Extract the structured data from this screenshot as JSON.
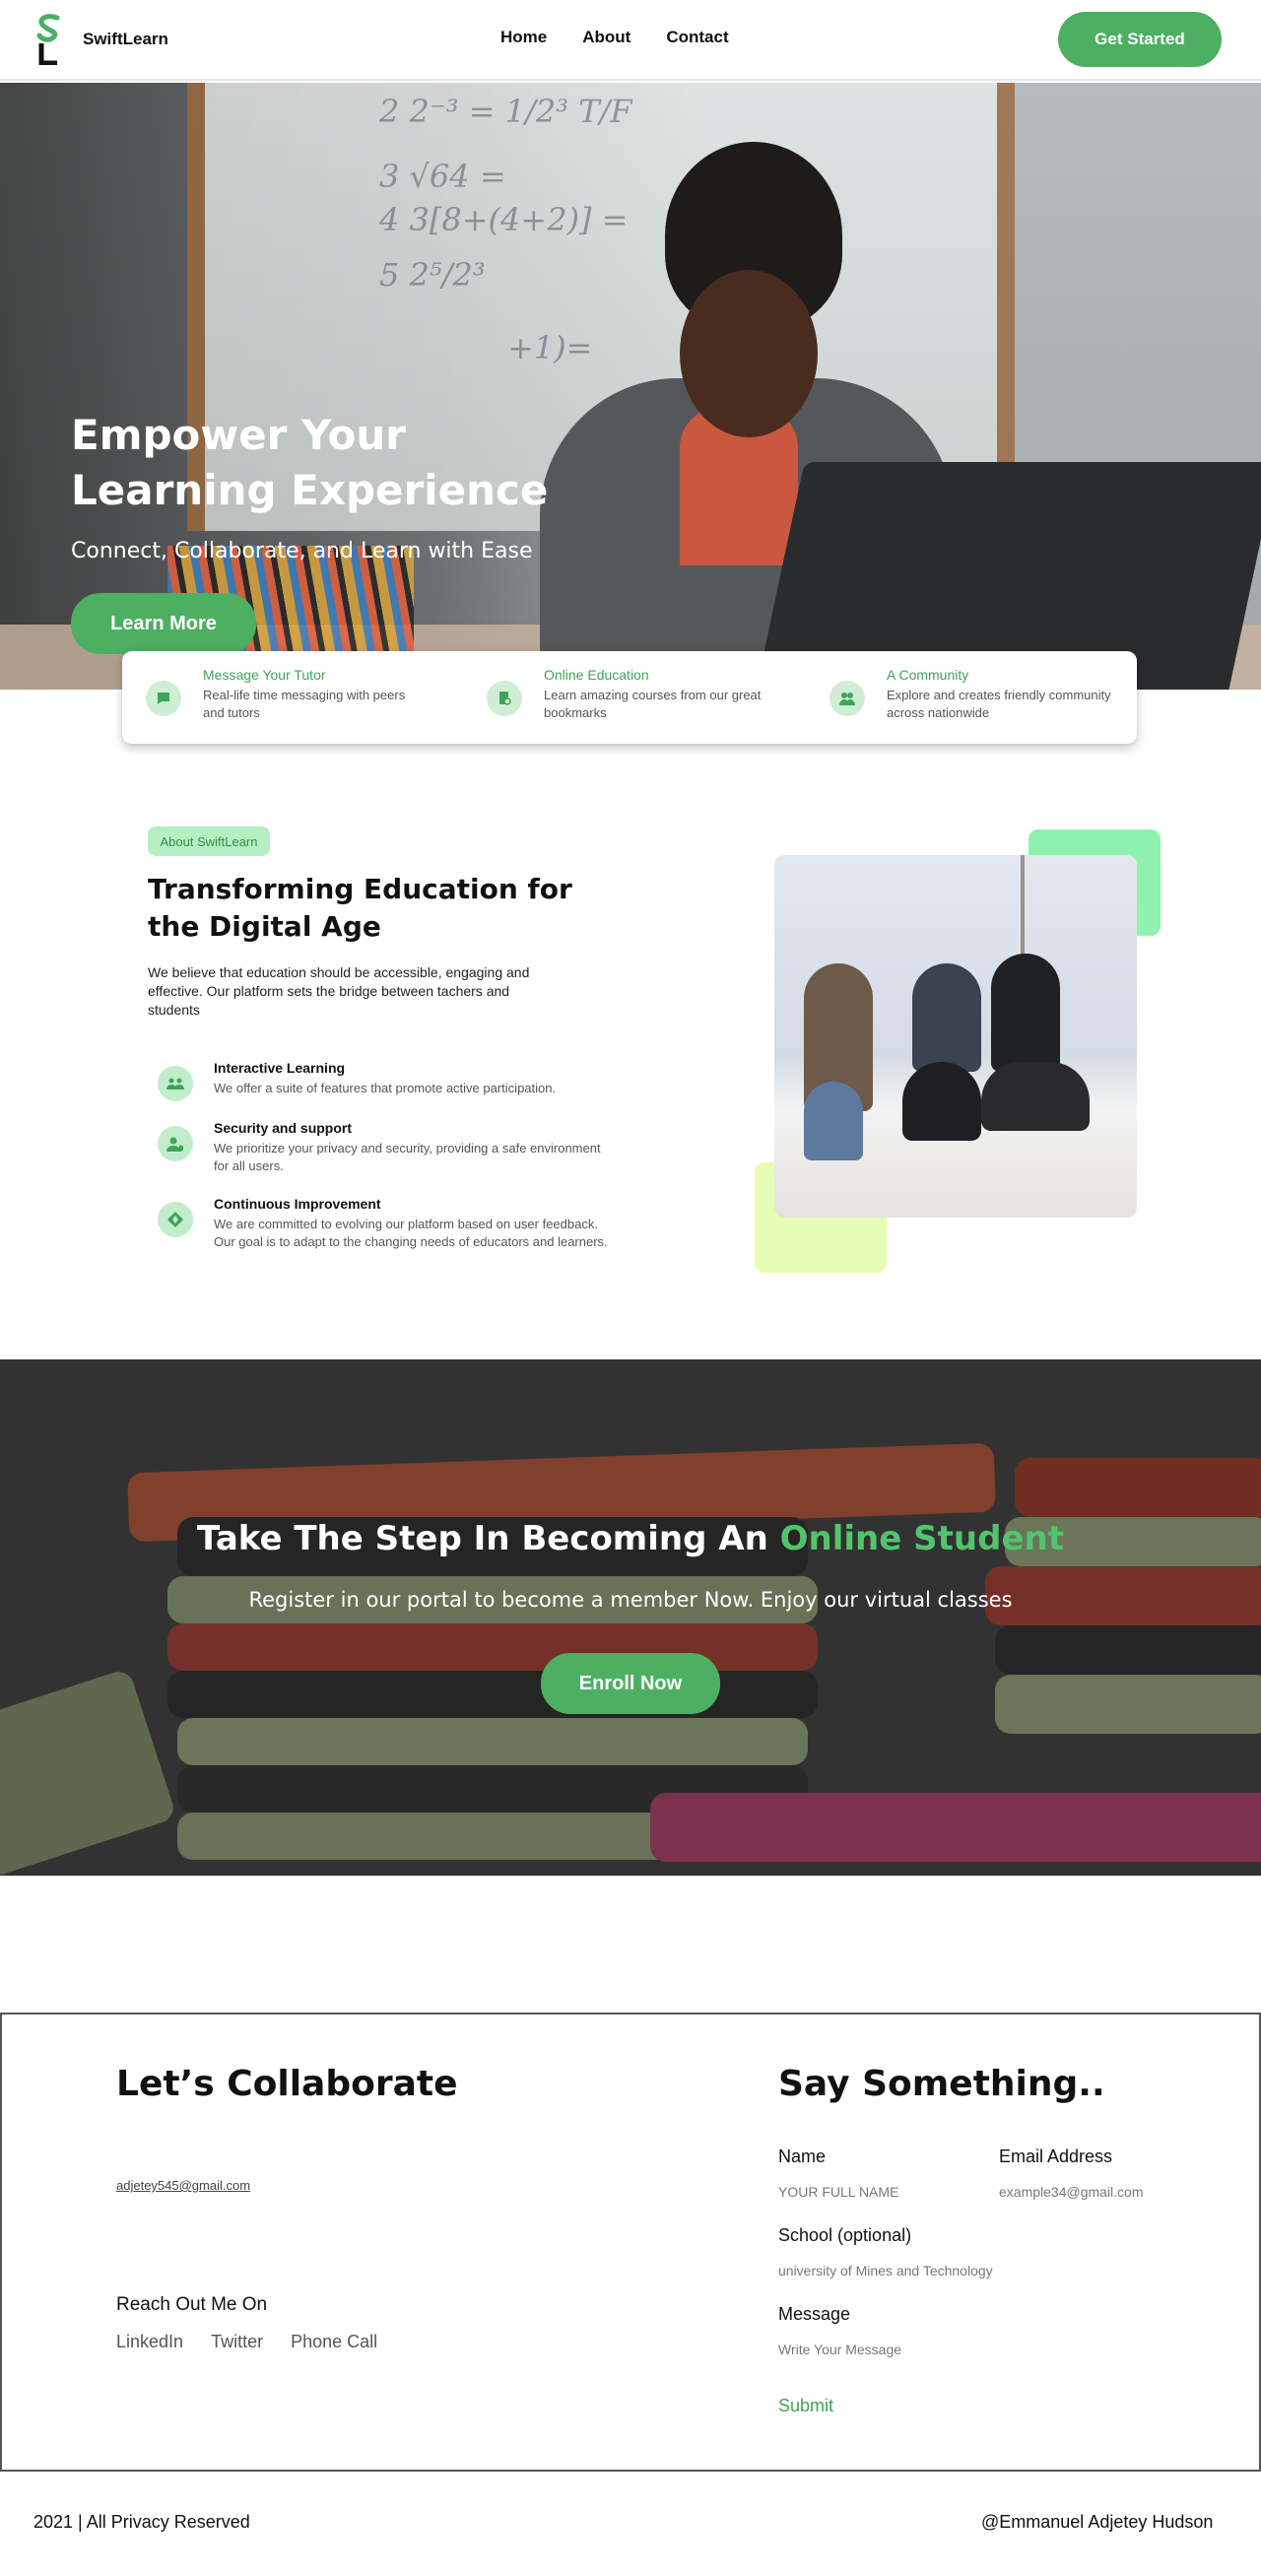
{
  "colors": {
    "accent": "#4caf62",
    "accent_text": "#3fa35a",
    "mint": "#8ff2ae",
    "lime": "#e7fcb4",
    "tag_bg": "#b7efc4"
  },
  "nav": {
    "brand": "SwiftLearn",
    "logo_letters": "SL",
    "links": [
      "Home",
      "About",
      "Contact"
    ],
    "cta": "Get Started"
  },
  "hero": {
    "title": "Empower Your Learning Experience",
    "subtitle": "Connect, Collaborate, and Learn with Ease",
    "button": "Learn More",
    "board_lines": [
      "2   2⁻³ = 1/2³   T/F",
      "3   √64 =",
      "4   3[8+(4+2)] =",
      "5   2⁵/2³",
      "+1)="
    ]
  },
  "features": [
    {
      "icon": "chat-icon",
      "title": "Message Your Tutor",
      "desc": "Real-life time messaging with peers and tutors"
    },
    {
      "icon": "book-icon",
      "title": "Online Education",
      "desc": "Learn amazing courses from our great bookmarks"
    },
    {
      "icon": "group-icon",
      "title": "A Community",
      "desc": "Explore and creates friendly community across nationwide"
    }
  ],
  "about": {
    "tag": "About SwiftLearn",
    "title": "Transforming Education for the Digital Age",
    "desc": "We believe that education should be accessible, engaging and effective. Our platform sets the bridge between tachers and students",
    "items": [
      {
        "icon": "users-icon",
        "title": "Interactive Learning",
        "desc": "We offer a suite of features that promote active participation."
      },
      {
        "icon": "user-shield-icon",
        "title": "Security and support",
        "desc": "We prioritize your privacy and security, providing a safe environment for all users."
      },
      {
        "icon": "diamond-icon",
        "title": "Continuous Improvement",
        "desc": "We are committed to evolving our platform based on user feedback. Our goal is to adapt to the changing needs of educators and learners."
      }
    ]
  },
  "cta": {
    "title_main": "Take The Step In Becoming An ",
    "title_highlight": "Online Student",
    "subtitle": "Register in our portal to become a member Now. Enjoy our virtual classes",
    "button": "Enroll Now"
  },
  "contact": {
    "left_title": "Let’s Collaborate",
    "email": "adjetey545@gmail.com",
    "reach_label": "Reach Out Me On",
    "links": [
      "LinkedIn",
      "Twitter",
      "Phone Call"
    ],
    "form_title": "Say Something..",
    "name_label": "Name",
    "name_placeholder": "YOUR FULL NAME",
    "email_label": "Email Address",
    "email_placeholder": "example34@gmail.com",
    "school_label": "School (optional)",
    "school_placeholder": "university of Mines and Technology",
    "message_label": "Message",
    "message_placeholder": "Write Your Message",
    "submit": "Submit"
  },
  "footer": {
    "left": "2021 | All Privacy Reserved",
    "right": "@Emmanuel Adjetey Hudson"
  }
}
